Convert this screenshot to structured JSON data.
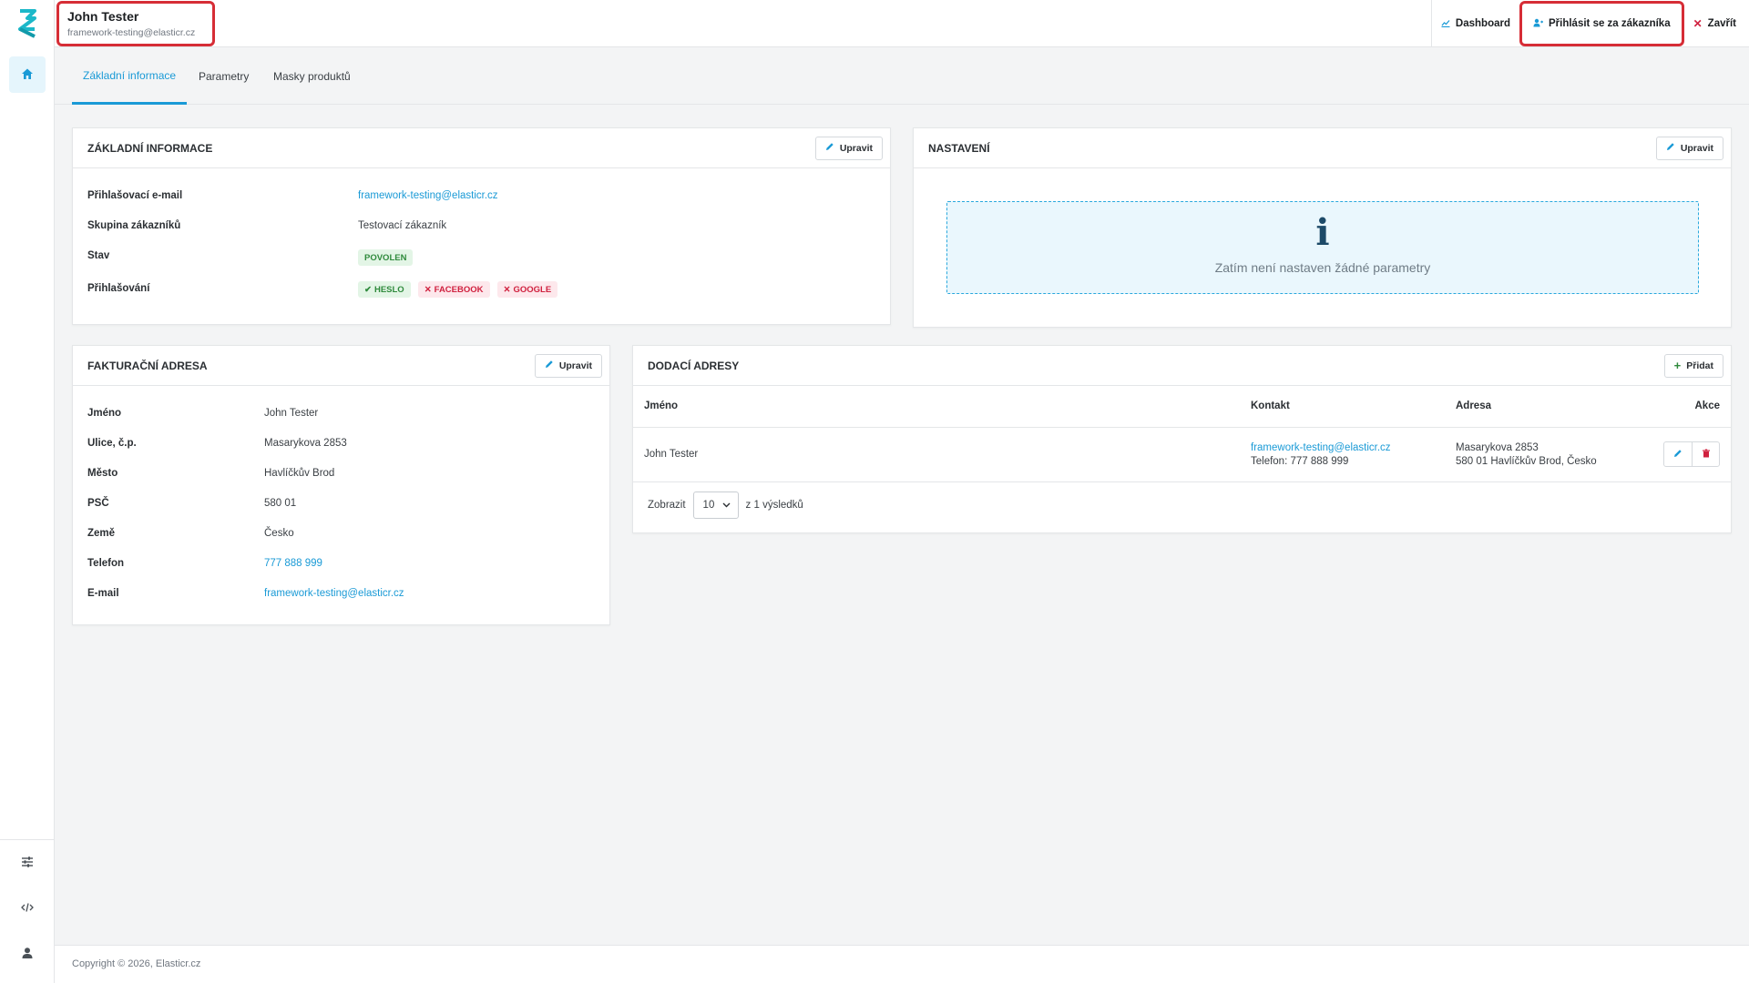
{
  "header": {
    "user_name": "John Tester",
    "user_email": "framework-testing@elasticr.cz",
    "actions": {
      "dashboard": "Dashboard",
      "login_as": "Přihlásit se za zákazníka",
      "close": "Zavřít"
    }
  },
  "tabs": [
    "Základní informace",
    "Parametry",
    "Masky produktů"
  ],
  "basic_info": {
    "title": "ZÁKLADNÍ INFORMACE",
    "edit": "Upravit",
    "rows": {
      "login_email_label": "Přihlašovací e-mail",
      "login_email_value": "framework-testing@elasticr.cz",
      "group_label": "Skupina zákazníků",
      "group_value": "Testovací zákazník",
      "status_label": "Stav",
      "status_value": "POVOLEN",
      "login_label": "Přihlašování",
      "login_methods": [
        "HESLO",
        "FACEBOOK",
        "GOOGLE"
      ]
    }
  },
  "settings": {
    "title": "NASTAVENÍ",
    "edit": "Upravit",
    "empty_icon": "info-icon",
    "empty_text": "Zatím není nastaven žádné parametry"
  },
  "billing": {
    "title": "FAKTURAČNÍ ADRESA",
    "edit": "Upravit",
    "labels": [
      "Jméno",
      "Ulice, č.p.",
      "Město",
      "PSČ",
      "Země",
      "Telefon",
      "E-mail"
    ],
    "values": [
      "John Tester",
      "Masarykova 2853",
      "Havlíčkův Brod",
      "580 01",
      "Česko",
      "777 888 999",
      "framework-testing@elasticr.cz"
    ]
  },
  "shipping": {
    "title": "DODACÍ ADRESY",
    "add": "Přidat",
    "columns": [
      "Jméno",
      "Kontakt",
      "Adresa",
      "Akce"
    ],
    "rows": [
      {
        "name": "John Tester",
        "contact_email": "framework-testing@elasticr.cz",
        "contact_phone": "Telefon: 777 888 999",
        "address_line1": "Masarykova 2853",
        "address_line2": "580 01 Havlíčkův Brod, Česko"
      }
    ],
    "pager": {
      "show_label": "Zobrazit",
      "page_size": "10",
      "results": "z 1 výsledků"
    }
  },
  "footer": {
    "copyright": "Copyright © 2026, Elasticr.cz"
  },
  "colors": {
    "accent": "#1a9ad6",
    "highlight_border": "#d62d36",
    "success": "#2f8a3c",
    "danger": "#d0213f"
  }
}
